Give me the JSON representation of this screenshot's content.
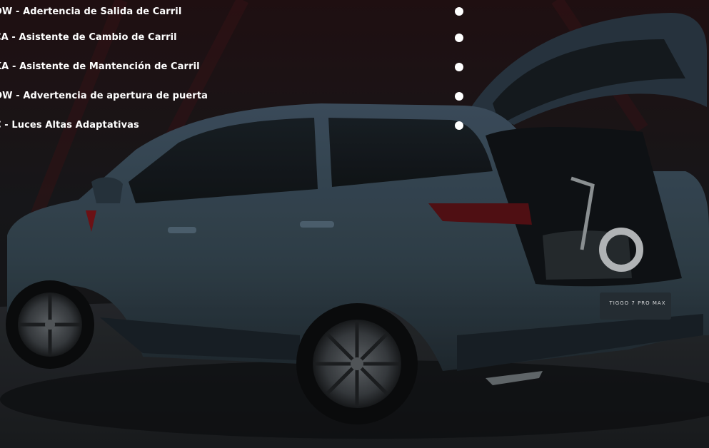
{
  "features": [
    {
      "label": "DW - Adertencia de Salida de Carril"
    },
    {
      "label": "CA - Asistente de Cambio de Carril"
    },
    {
      "label": "KA - Asistente de Mantención de Carril"
    },
    {
      "label": "OW - Advertencia de apertura de puerta"
    },
    {
      "label": "C - Luces Altas Adaptativas"
    }
  ],
  "vehicle": {
    "badge_text": "TIGGO 7 PRO MAX"
  },
  "colors": {
    "background": "#151719",
    "text": "#ffffff",
    "car_body": "#3a4c5c",
    "accent_red": "#7a1418"
  }
}
